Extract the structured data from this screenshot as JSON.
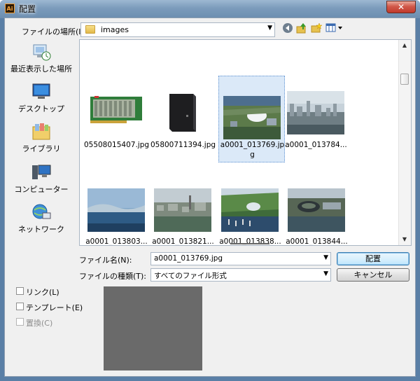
{
  "window": {
    "title": "配置",
    "app_icon": "Ai",
    "close_symbol": "✕"
  },
  "lookin": {
    "label": "ファイルの場所(I):",
    "value": "images"
  },
  "toolbar": {
    "back_symbol": "◀",
    "up_symbol": "↑",
    "newfolder_symbol": "✱",
    "views_symbol": "▦▾"
  },
  "places": [
    {
      "label": "最近表示した場所",
      "icon": "recent-places-icon"
    },
    {
      "label": "デスクトップ",
      "icon": "desktop-icon"
    },
    {
      "label": "ライブラリ",
      "icon": "libraries-icon"
    },
    {
      "label": "コンピューター",
      "icon": "computer-icon"
    },
    {
      "label": "ネットワーク",
      "icon": "network-icon"
    }
  ],
  "files": [
    {
      "name": "05508015407.jpg"
    },
    {
      "name": "05800711394.jpg"
    },
    {
      "name_line1": "a0001_013769.jp",
      "name_line2": "g"
    },
    {
      "name": "a0001_013784..."
    },
    {
      "name": "a0001_013803..."
    },
    {
      "name": "a0001_013821..."
    },
    {
      "name": "a0001_013838..."
    },
    {
      "name": "a0001_013844..."
    }
  ],
  "filename": {
    "label": "ファイル名(N):",
    "value": "a0001_013769.jpg"
  },
  "filetype": {
    "label": "ファイルの種類(T):",
    "value": "すべてのファイル形式"
  },
  "buttons": {
    "place": "配置",
    "cancel": "キャンセル"
  },
  "options": {
    "link": "リンク(L)",
    "template": "テンプレート(E)",
    "replace": "置換(C)"
  },
  "colors": {
    "titlebar": "#7b9bbb",
    "close": "#c0392b",
    "selection": "#dbe9f8",
    "preview": "#6a6a6a"
  }
}
